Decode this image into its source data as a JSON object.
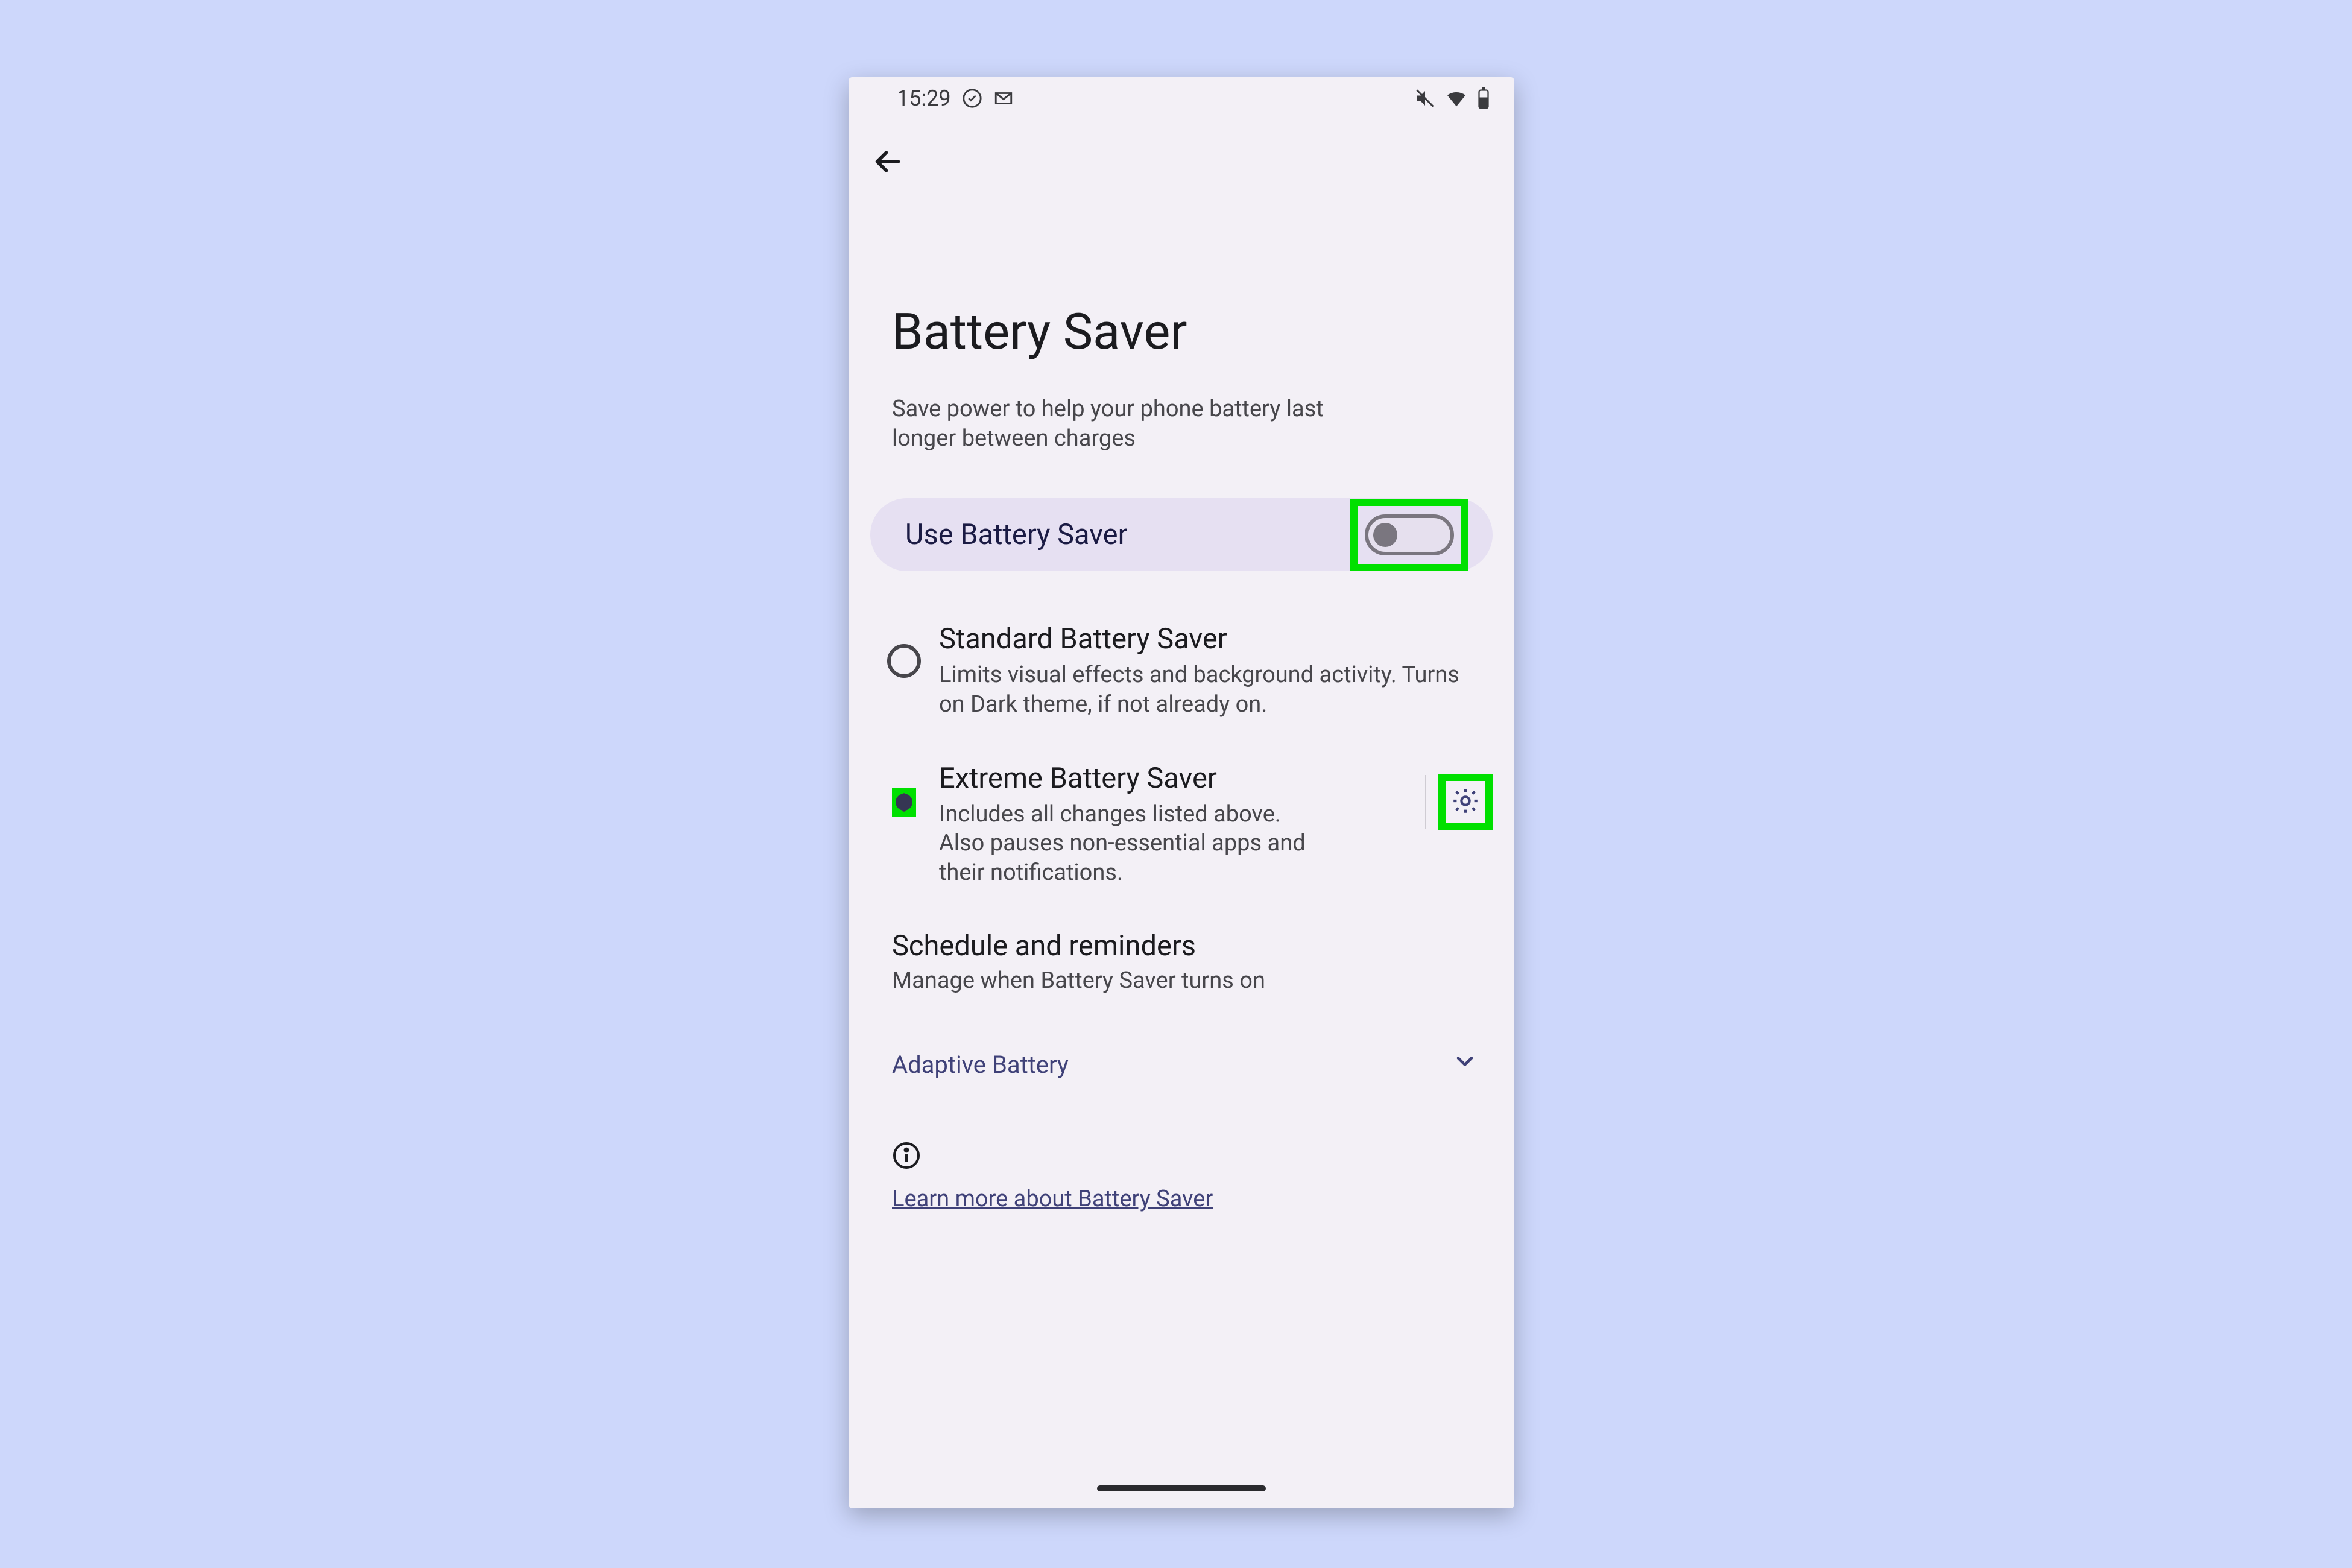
{
  "status": {
    "time": "15:29"
  },
  "page": {
    "title": "Battery Saver",
    "subtitle": "Save power to help your phone battery last longer between charges"
  },
  "toggle": {
    "label": "Use Battery Saver",
    "on": false
  },
  "options": [
    {
      "title": "Standard Battery Saver",
      "desc": "Limits visual effects and background activity. Turns on Dark theme, if not already on.",
      "selected": false
    },
    {
      "title": "Extreme Battery Saver",
      "desc": "Includes all changes listed above. Also pauses non-essential apps and their notifications.",
      "selected": true
    }
  ],
  "schedule": {
    "title": "Schedule and reminders",
    "desc": "Manage when Battery Saver turns on"
  },
  "adaptive": {
    "label": "Adaptive Battery"
  },
  "learn_more": "Learn more about Battery Saver",
  "highlight_color": "#00e000"
}
